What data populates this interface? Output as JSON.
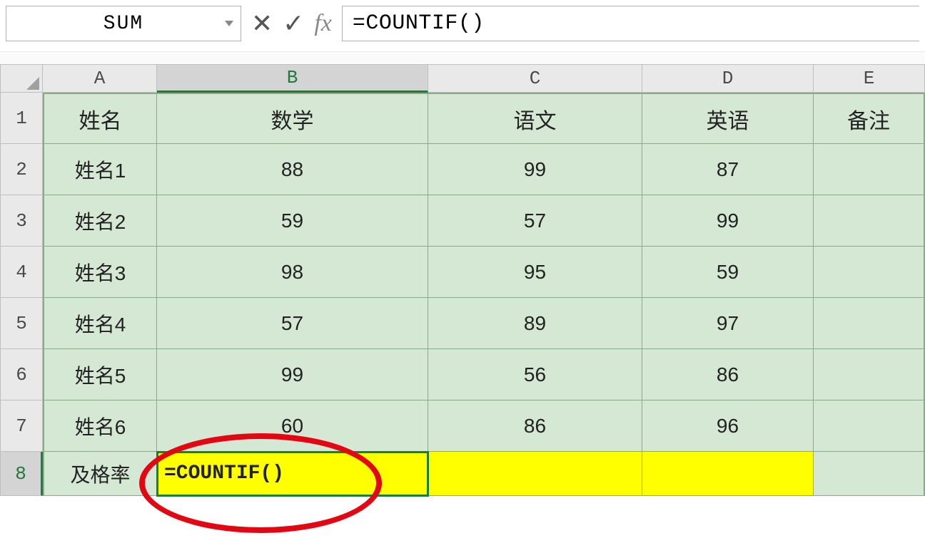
{
  "name_box": "SUM",
  "formula_input": "=COUNTIF()",
  "columns": [
    "A",
    "B",
    "C",
    "D",
    "E"
  ],
  "rows": [
    "1",
    "2",
    "3",
    "4",
    "5",
    "6",
    "7",
    "8"
  ],
  "header_row": {
    "A": "姓名",
    "B": "数学",
    "C": "语文",
    "D": "英语",
    "E": "备注"
  },
  "data_rows": [
    {
      "A": "姓名1",
      "B": "88",
      "C": "99",
      "D": "87",
      "E": ""
    },
    {
      "A": "姓名2",
      "B": "59",
      "C": "57",
      "D": "99",
      "E": ""
    },
    {
      "A": "姓名3",
      "B": "98",
      "C": "95",
      "D": "59",
      "E": ""
    },
    {
      "A": "姓名4",
      "B": "57",
      "C": "89",
      "D": "97",
      "E": ""
    },
    {
      "A": "姓名5",
      "B": "99",
      "C": "56",
      "D": "86",
      "E": ""
    },
    {
      "A": "姓名6",
      "B": "60",
      "C": "86",
      "D": "96",
      "E": ""
    }
  ],
  "footer_row": {
    "A": "及格率",
    "B": "=COUNTIF()",
    "C": "",
    "D": "",
    "E": ""
  },
  "active_cell": "B8",
  "annotation": "red-ellipse-circling-B8"
}
